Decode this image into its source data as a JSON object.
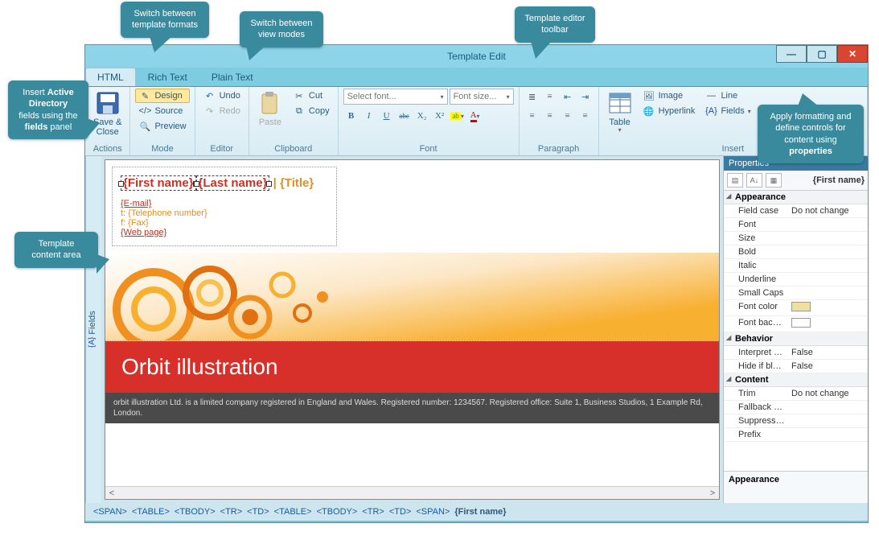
{
  "callouts": {
    "formats": "Switch between\ntemplate formats",
    "views": "Switch between\nview modes",
    "toolbar": "Template editor\ntoolbar",
    "fields": "Insert Active\nDirectory fields\nusing the fields\npanel",
    "content": "Template content\narea",
    "props": "Apply formatting and\ndefine controls for\ncontent using\nproperties"
  },
  "window": {
    "title": "Template Edit"
  },
  "tabs": {
    "html": "HTML",
    "richtext": "Rich Text",
    "plaintext": "Plain Text"
  },
  "ribbon": {
    "actions": {
      "label": "Actions",
      "saveclose": "Save &\nClose"
    },
    "mode": {
      "label": "Mode",
      "design": "Design",
      "source": "Source",
      "preview": "Preview"
    },
    "editor": {
      "label": "Editor",
      "undo": "Undo",
      "redo": "Redo"
    },
    "clipboard": {
      "label": "Clipboard",
      "paste": "Paste",
      "cut": "Cut",
      "copy": "Copy"
    },
    "font": {
      "label": "Font",
      "fontsel": "Select font...",
      "sizesel": "Font size...",
      "b": "B",
      "i": "I",
      "u": "U",
      "s": "abc",
      "sub": "X₂",
      "sup": "X²"
    },
    "paragraph": {
      "label": "Paragraph"
    },
    "insert": {
      "label": "Insert",
      "table": "Table",
      "image": "Image",
      "hyperlink": "Hyperlink",
      "line": "Line",
      "fields": "Fields"
    }
  },
  "fieldsTab": {
    "label": "Fields",
    "icon": "{A}"
  },
  "signature": {
    "firstname": "{First name}",
    "lastname": "{Last name}",
    "title": "{Title}",
    "sep": " | ",
    "email": "{E-mail}",
    "tel_prefix": "t: ",
    "tel": "{Telephone number}",
    "fax_prefix": "f: ",
    "fax": "{Fax}",
    "web": "{Web page}"
  },
  "brand": {
    "name": "Orbit illustration",
    "footer": "orbit illustration Ltd. is a limited company registered in England and Wales. Registered number: 1234567. Registered office: Suite 1, Business Studios, 1 Example Rd, London."
  },
  "breadcrumb": {
    "items": [
      "<SPAN>",
      "<TABLE>",
      "<TBODY>",
      "<TR>",
      "<TD>",
      "<TABLE>",
      "<TBODY>",
      "<TR>",
      "<TD>",
      "<SPAN>"
    ],
    "current": "{First name}"
  },
  "properties": {
    "title": "Properties",
    "object": "{First name}",
    "footer": "Appearance",
    "groups": [
      {
        "name": "Appearance",
        "rows": [
          {
            "n": "Field case",
            "v": "Do not change"
          },
          {
            "n": "Font",
            "v": ""
          },
          {
            "n": "Size",
            "v": ""
          },
          {
            "n": "Bold",
            "v": ""
          },
          {
            "n": "Italic",
            "v": ""
          },
          {
            "n": "Underline",
            "v": ""
          },
          {
            "n": "Small Caps",
            "v": ""
          },
          {
            "n": "Font color",
            "v": "__swatch_orange"
          },
          {
            "n": "Font background",
            "v": "__swatch_white"
          }
        ]
      },
      {
        "name": "Behavior",
        "rows": [
          {
            "n": "Interpret markup",
            "v": "False"
          },
          {
            "n": "Hide if blank",
            "v": "False"
          }
        ]
      },
      {
        "name": "Content",
        "rows": [
          {
            "n": "Trim",
            "v": "Do not change"
          },
          {
            "n": "Fallback value",
            "v": ""
          },
          {
            "n": "Suppress newlines",
            "v": ""
          },
          {
            "n": "Prefix",
            "v": ""
          }
        ]
      }
    ]
  }
}
